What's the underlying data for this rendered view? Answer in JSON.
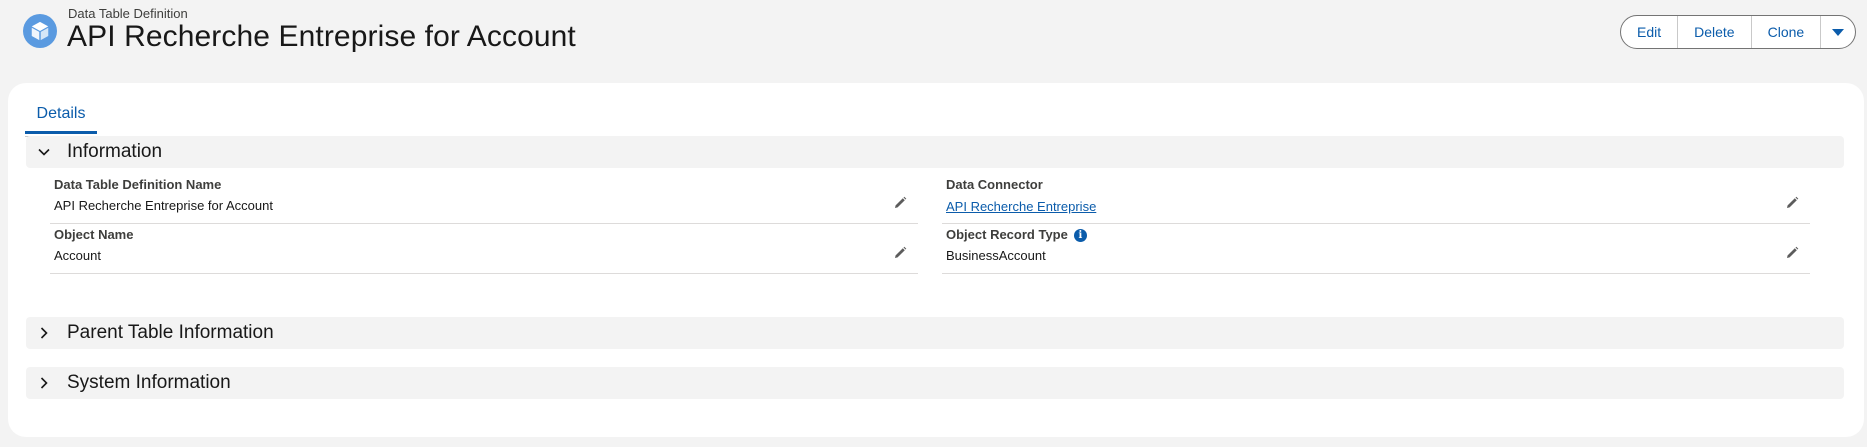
{
  "header": {
    "object_type": "Data Table Definition",
    "title": "API Recherche Entreprise for Account",
    "icon": "cube-icon",
    "actions": {
      "edit": "Edit",
      "delete": "Delete",
      "clone": "Clone",
      "more_icon": "chevron-down-icon"
    }
  },
  "tabs": [
    {
      "label": "Details",
      "active": true
    }
  ],
  "sections": {
    "information": {
      "title": "Information",
      "expanded": true,
      "fields": {
        "dtd_name": {
          "label": "Data Table Definition Name",
          "value": "API Recherche Entreprise for Account"
        },
        "data_connector": {
          "label": "Data Connector",
          "value": "API Recherche Entreprise"
        },
        "object_name": {
          "label": "Object Name",
          "value": "Account"
        },
        "object_record_type": {
          "label": "Object Record Type",
          "value": "BusinessAccount",
          "info_icon": "info-icon"
        }
      }
    },
    "parent_table": {
      "title": "Parent Table Information",
      "expanded": false
    },
    "system": {
      "title": "System Information",
      "expanded": false
    }
  },
  "colors": {
    "brand": "#0b5cab",
    "object_icon": "#5a9ae0",
    "background": "#f3f3f3"
  }
}
